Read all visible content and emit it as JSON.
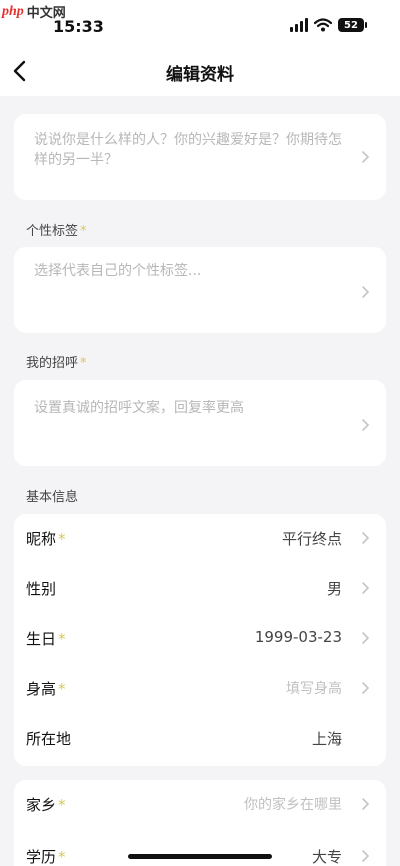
{
  "status": {
    "watermark_php": "php",
    "watermark_site": "中文网",
    "time": "15:33",
    "battery": "52"
  },
  "nav": {
    "title": "编辑资料"
  },
  "intro": {
    "placeholder": "说说你是什么样的人？你的兴趣爱好是？你期待怎样的另一半？"
  },
  "tags": {
    "label": "个性标签",
    "placeholder": "选择代表自己的个性标签..."
  },
  "greeting": {
    "label": "我的招呼",
    "placeholder": "设置真诚的招呼文案，回复率更高"
  },
  "basic": {
    "label": "基本信息",
    "rows": [
      {
        "label": "昵称",
        "value": "平行终点"
      },
      {
        "label": "性别",
        "value": "男"
      },
      {
        "label": "生日",
        "value": "1999-03-23"
      },
      {
        "label": "身高",
        "value": "填写身高"
      },
      {
        "label": "所在地",
        "value": "上海"
      }
    ]
  },
  "more": {
    "rows": [
      {
        "label": "家乡",
        "value": "你的家乡在哪里"
      },
      {
        "label": "学历",
        "value": "大专"
      }
    ]
  },
  "colors": {
    "required_star": "#d6c95c",
    "background": "#f4f4f6"
  }
}
